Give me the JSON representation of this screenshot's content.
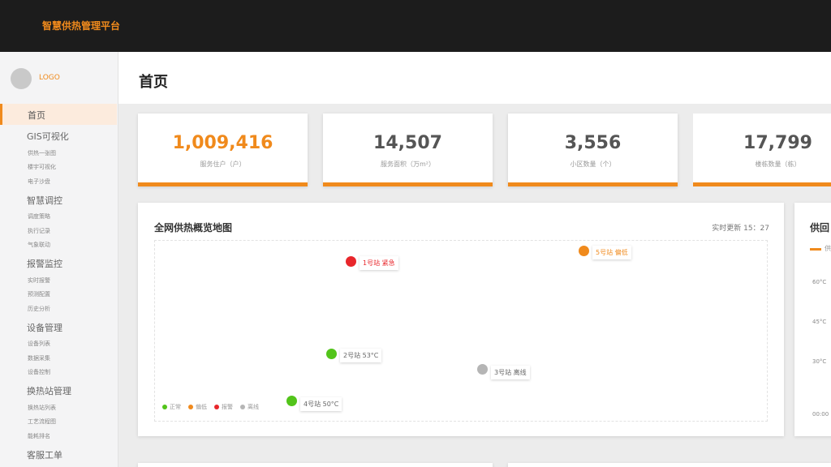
{
  "app": {
    "title": "智慧供热管理平台"
  },
  "sidebar": {
    "logo": "LOGO",
    "home": "首页",
    "groups": [
      {
        "label": "GIS可视化",
        "items": [
          "供热一张图",
          "楼宇可视化",
          "电子沙盘"
        ]
      },
      {
        "label": "智慧调控",
        "items": [
          "调度策略",
          "执行记录",
          "气象联动"
        ]
      },
      {
        "label": "报警监控",
        "items": [
          "实时报警",
          "预测配置",
          "历史分析"
        ]
      },
      {
        "label": "设备管理",
        "items": [
          "设备列表",
          "数据采集",
          "设备控制"
        ]
      },
      {
        "label": "换热站管理",
        "items": [
          "换热站列表",
          "工艺流程图",
          "能耗排名"
        ]
      },
      {
        "label": "客服工单",
        "items": []
      }
    ]
  },
  "page": {
    "title": "首页"
  },
  "stats": [
    {
      "value": "1,009,416",
      "label": "服务住户（户）"
    },
    {
      "value": "14,507",
      "label": "服务面积（万m²）"
    },
    {
      "value": "3,556",
      "label": "小区数量（个）"
    },
    {
      "value": "17,799",
      "label": "楼栋数量（栋）"
    }
  ],
  "map": {
    "title": "全网供热概览地图",
    "update": "实时更新 15：27",
    "stations": [
      {
        "label": "1号站 紧急",
        "status": "alarm"
      },
      {
        "label": "5号站 偏低",
        "status": "low"
      },
      {
        "label": "2号站 53°C",
        "status": "normal"
      },
      {
        "label": "3号站 离线",
        "status": "offline"
      },
      {
        "label": "4号站 50°C",
        "status": "normal"
      }
    ],
    "legend": [
      {
        "label": "正常",
        "color": "#52c41a"
      },
      {
        "label": "偏低",
        "color": "#f08a1c"
      },
      {
        "label": "报警",
        "color": "#e8262b"
      },
      {
        "label": "离线",
        "color": "#b5b5b5"
      }
    ]
  },
  "side_chart": {
    "title": "供回",
    "legend": "供",
    "yticks": [
      "60°C",
      "45°C",
      "30°C",
      "00:00"
    ]
  },
  "colors": {
    "accent": "#f08a1c",
    "normal": "#52c41a",
    "alarm": "#e8262b",
    "offline": "#b5b5b5",
    "topbar": "#1c1c1c"
  }
}
